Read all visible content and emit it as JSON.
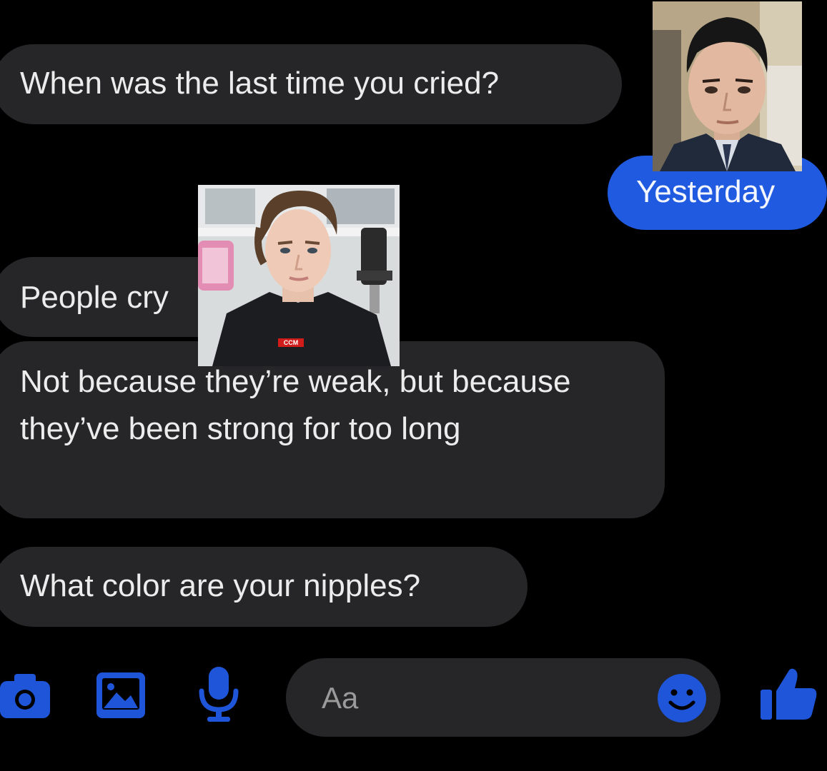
{
  "messages": [
    {
      "id": "m1",
      "direction": "received",
      "text": "When was the last time you cried?"
    },
    {
      "id": "m2",
      "direction": "sent",
      "text": "Yesterday"
    },
    {
      "id": "m3",
      "direction": "received",
      "text": "People cry"
    },
    {
      "id": "m4",
      "direction": "received",
      "text": "Not because they’re weak, but because they’ve been strong for too long"
    },
    {
      "id": "m5",
      "direction": "received",
      "text": "What color are your nipples?"
    }
  ],
  "overlay_images": [
    {
      "id": "photo-right",
      "description_icon": "portrait-photo"
    },
    {
      "id": "photo-center",
      "description_icon": "portrait-photo",
      "shirt_logo": "CCM"
    }
  ],
  "composer": {
    "placeholder": "Aa"
  },
  "toolbar": {
    "icons": [
      "camera-icon",
      "gallery-icon",
      "microphone-icon",
      "emoji-icon",
      "thumbs-up-icon"
    ]
  },
  "colors": {
    "background": "#000000",
    "received_bubble": "#262628",
    "sent_bubble": "#1f5ae0",
    "accent": "#1f5ae0"
  }
}
